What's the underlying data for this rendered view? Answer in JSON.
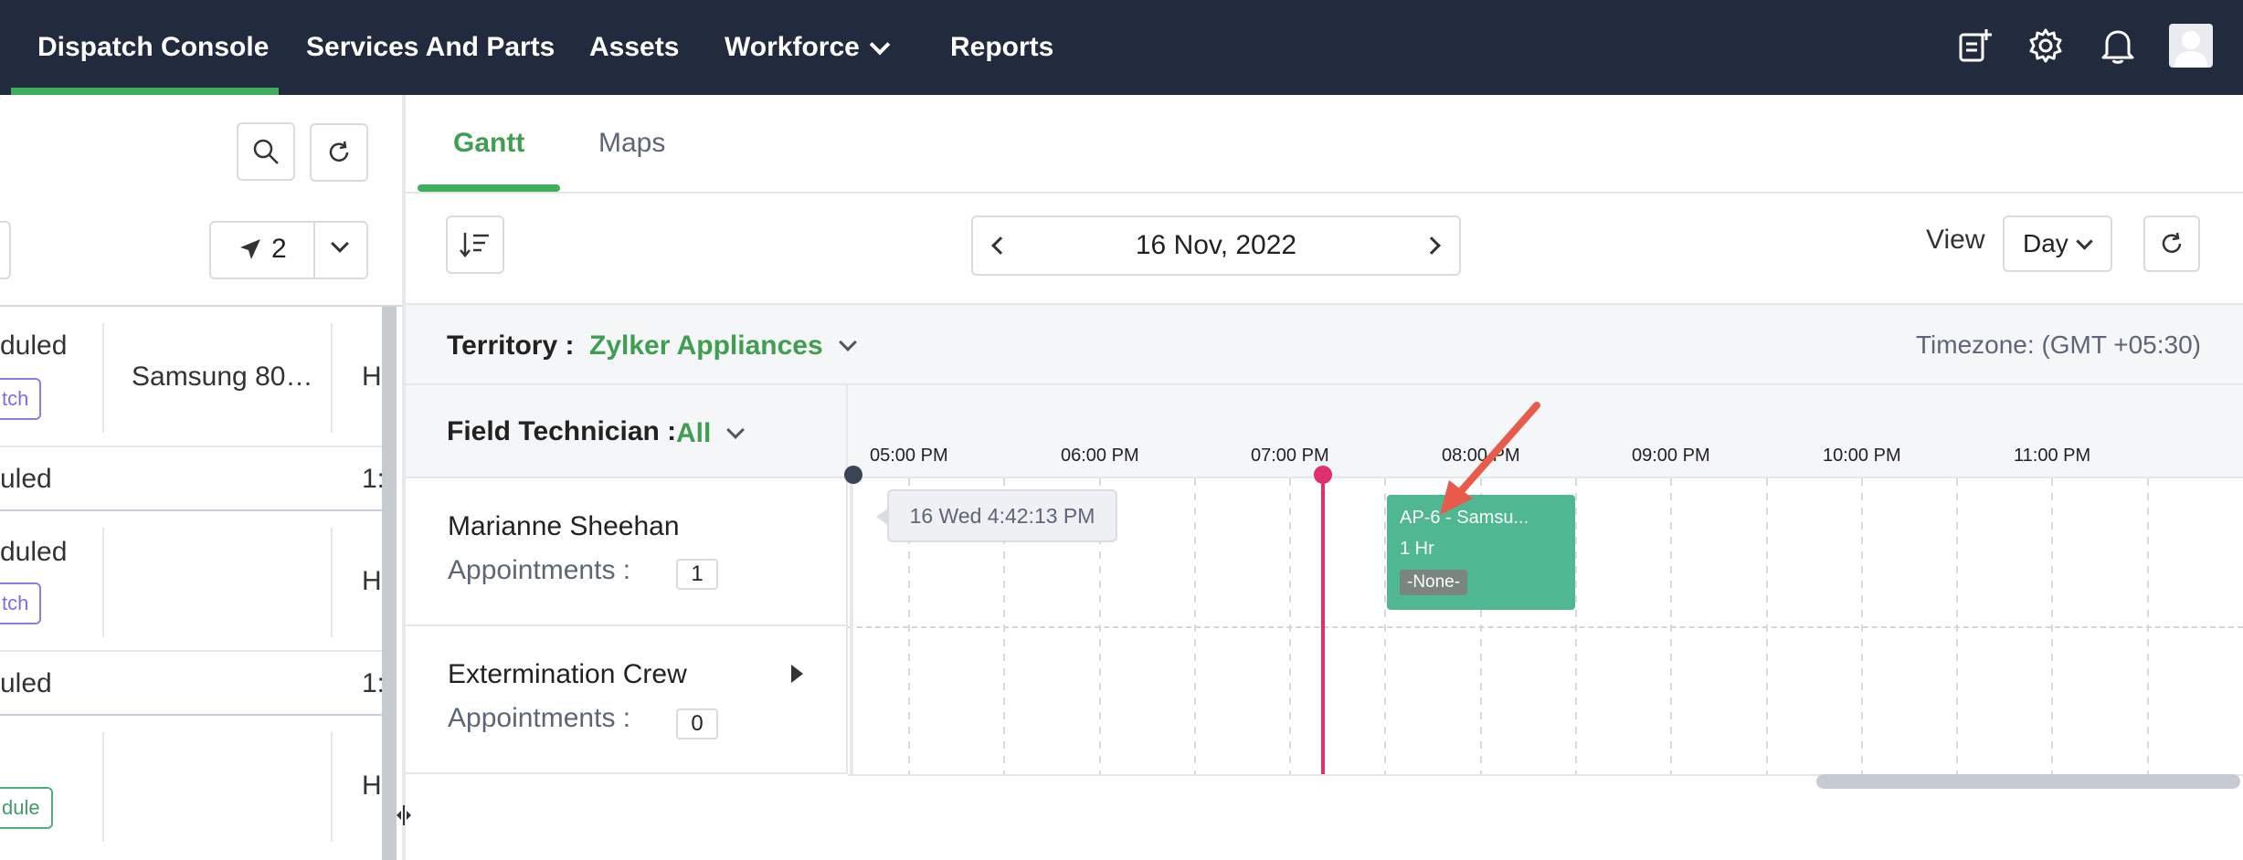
{
  "nav": {
    "items": [
      {
        "label": "Dispatch Console"
      },
      {
        "label": "Services And Parts"
      },
      {
        "label": "Assets"
      },
      {
        "label": "Workforce"
      },
      {
        "label": "Reports"
      }
    ],
    "icons": [
      "add-note-icon",
      "gear-icon",
      "bell-icon",
      "avatar"
    ]
  },
  "left_panel": {
    "dispatch_count": "2",
    "rows": [
      {
        "status": "duled",
        "badge": "tch",
        "asset": "Samsung 80…",
        "extra": "H"
      },
      {
        "status": "uled",
        "extra": "1:"
      },
      {
        "status": "duled",
        "badge": "tch",
        "extra": "H"
      },
      {
        "status": "uled",
        "extra": "1:"
      },
      {
        "badge": "dule",
        "extra": "H"
      }
    ]
  },
  "tabs": {
    "gantt": "Gantt",
    "maps": "Maps"
  },
  "toolbar": {
    "date": "16 Nov, 2022",
    "view_label": "View",
    "view_value": "Day"
  },
  "territory": {
    "label": "Territory :",
    "value": "Zylker Appliances",
    "timezone": "Timezone: (GMT +05:30)"
  },
  "gantt": {
    "field_label": "Field Technician :",
    "field_value": "All",
    "time_slots": [
      "05:00 PM",
      "06:00 PM",
      "07:00 PM",
      "08:00 PM",
      "09:00 PM",
      "10:00 PM",
      "11:00 PM"
    ],
    "current_time_tooltip": "16 Wed 4:42:13 PM",
    "resources": [
      {
        "name": "Marianne Sheehan",
        "appointments_label": "Appointments :",
        "count": "1"
      },
      {
        "name": "Extermination Crew",
        "appointments_label": "Appointments :",
        "count": "0"
      }
    ],
    "appointment": {
      "title": "AP-6  - Samsu...",
      "duration": "1 Hr",
      "tag": "-None-"
    }
  },
  "colors": {
    "nav_bg": "#222b3d",
    "accent_green": "#3fae5c",
    "now_line": "#e12f6d",
    "appointment": "#4fb791"
  }
}
